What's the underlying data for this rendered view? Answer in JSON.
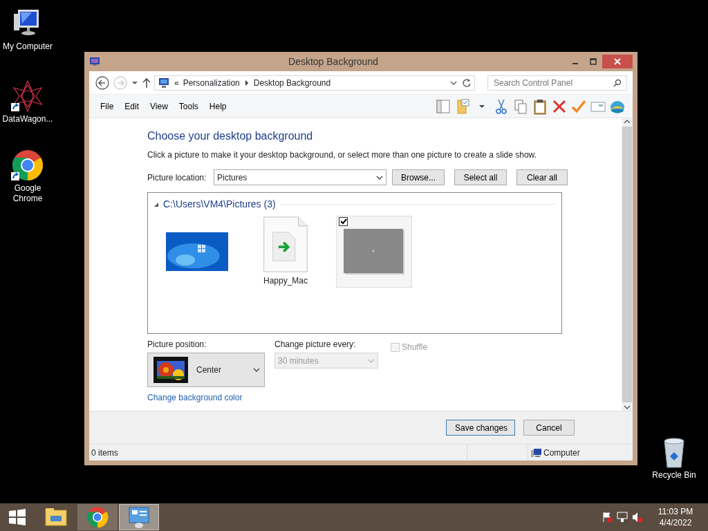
{
  "desktop_icons": [
    {
      "label": "My Computer",
      "kind": "computer",
      "shortcut": false
    },
    {
      "label": "DataWagon...",
      "kind": "star",
      "shortcut": true
    },
    {
      "label": "Google Chrome",
      "kind": "chrome",
      "shortcut": true
    },
    {
      "label": "Recycle Bin",
      "kind": "bin",
      "shortcut": false
    }
  ],
  "window": {
    "title": "Desktop Background",
    "address": {
      "prefix": "«",
      "crumbs": [
        "Personalization",
        "Desktop Background"
      ]
    },
    "search": {
      "placeholder": "Search Control Panel"
    },
    "menu": [
      "File",
      "Edit",
      "View",
      "Tools",
      "Help"
    ],
    "heading": "Choose your desktop background",
    "instructions": "Click a picture to make it your desktop background, or select more than one picture to create a slide show.",
    "picture_location": {
      "label": "Picture location:",
      "value": "Pictures"
    },
    "location_buttons": [
      "Browse...",
      "Select all",
      "Clear all"
    ],
    "group": {
      "title": "C:\\Users\\VM4\\Pictures (3)",
      "expanded": true
    },
    "pictures": [
      {
        "kind": "blue",
        "checked": false,
        "selected": false
      },
      {
        "kind": "file",
        "label": "Happy_Mac",
        "checked": false,
        "selected": false
      },
      {
        "kind": "gray",
        "checked": true,
        "selected": true
      }
    ],
    "picture_position": {
      "label": "Picture position:",
      "value": "Center"
    },
    "change_every": {
      "label": "Change picture every:",
      "value": "30 minutes",
      "disabled": true
    },
    "shuffle": {
      "label": "Shuffle",
      "checked": false,
      "disabled": true
    },
    "link": "Change background color",
    "actions": [
      "Save changes",
      "Cancel"
    ],
    "status_bar": {
      "items": "0 items",
      "zone": "Computer"
    }
  },
  "taskbar": {
    "apps": [
      {
        "kind": "explorer",
        "selected": false,
        "open": false
      },
      {
        "kind": "chrome",
        "selected": false,
        "open": true
      },
      {
        "kind": "control-panel",
        "selected": true,
        "open": true
      }
    ],
    "time": "11:03 PM",
    "date": "4/4/2022"
  }
}
